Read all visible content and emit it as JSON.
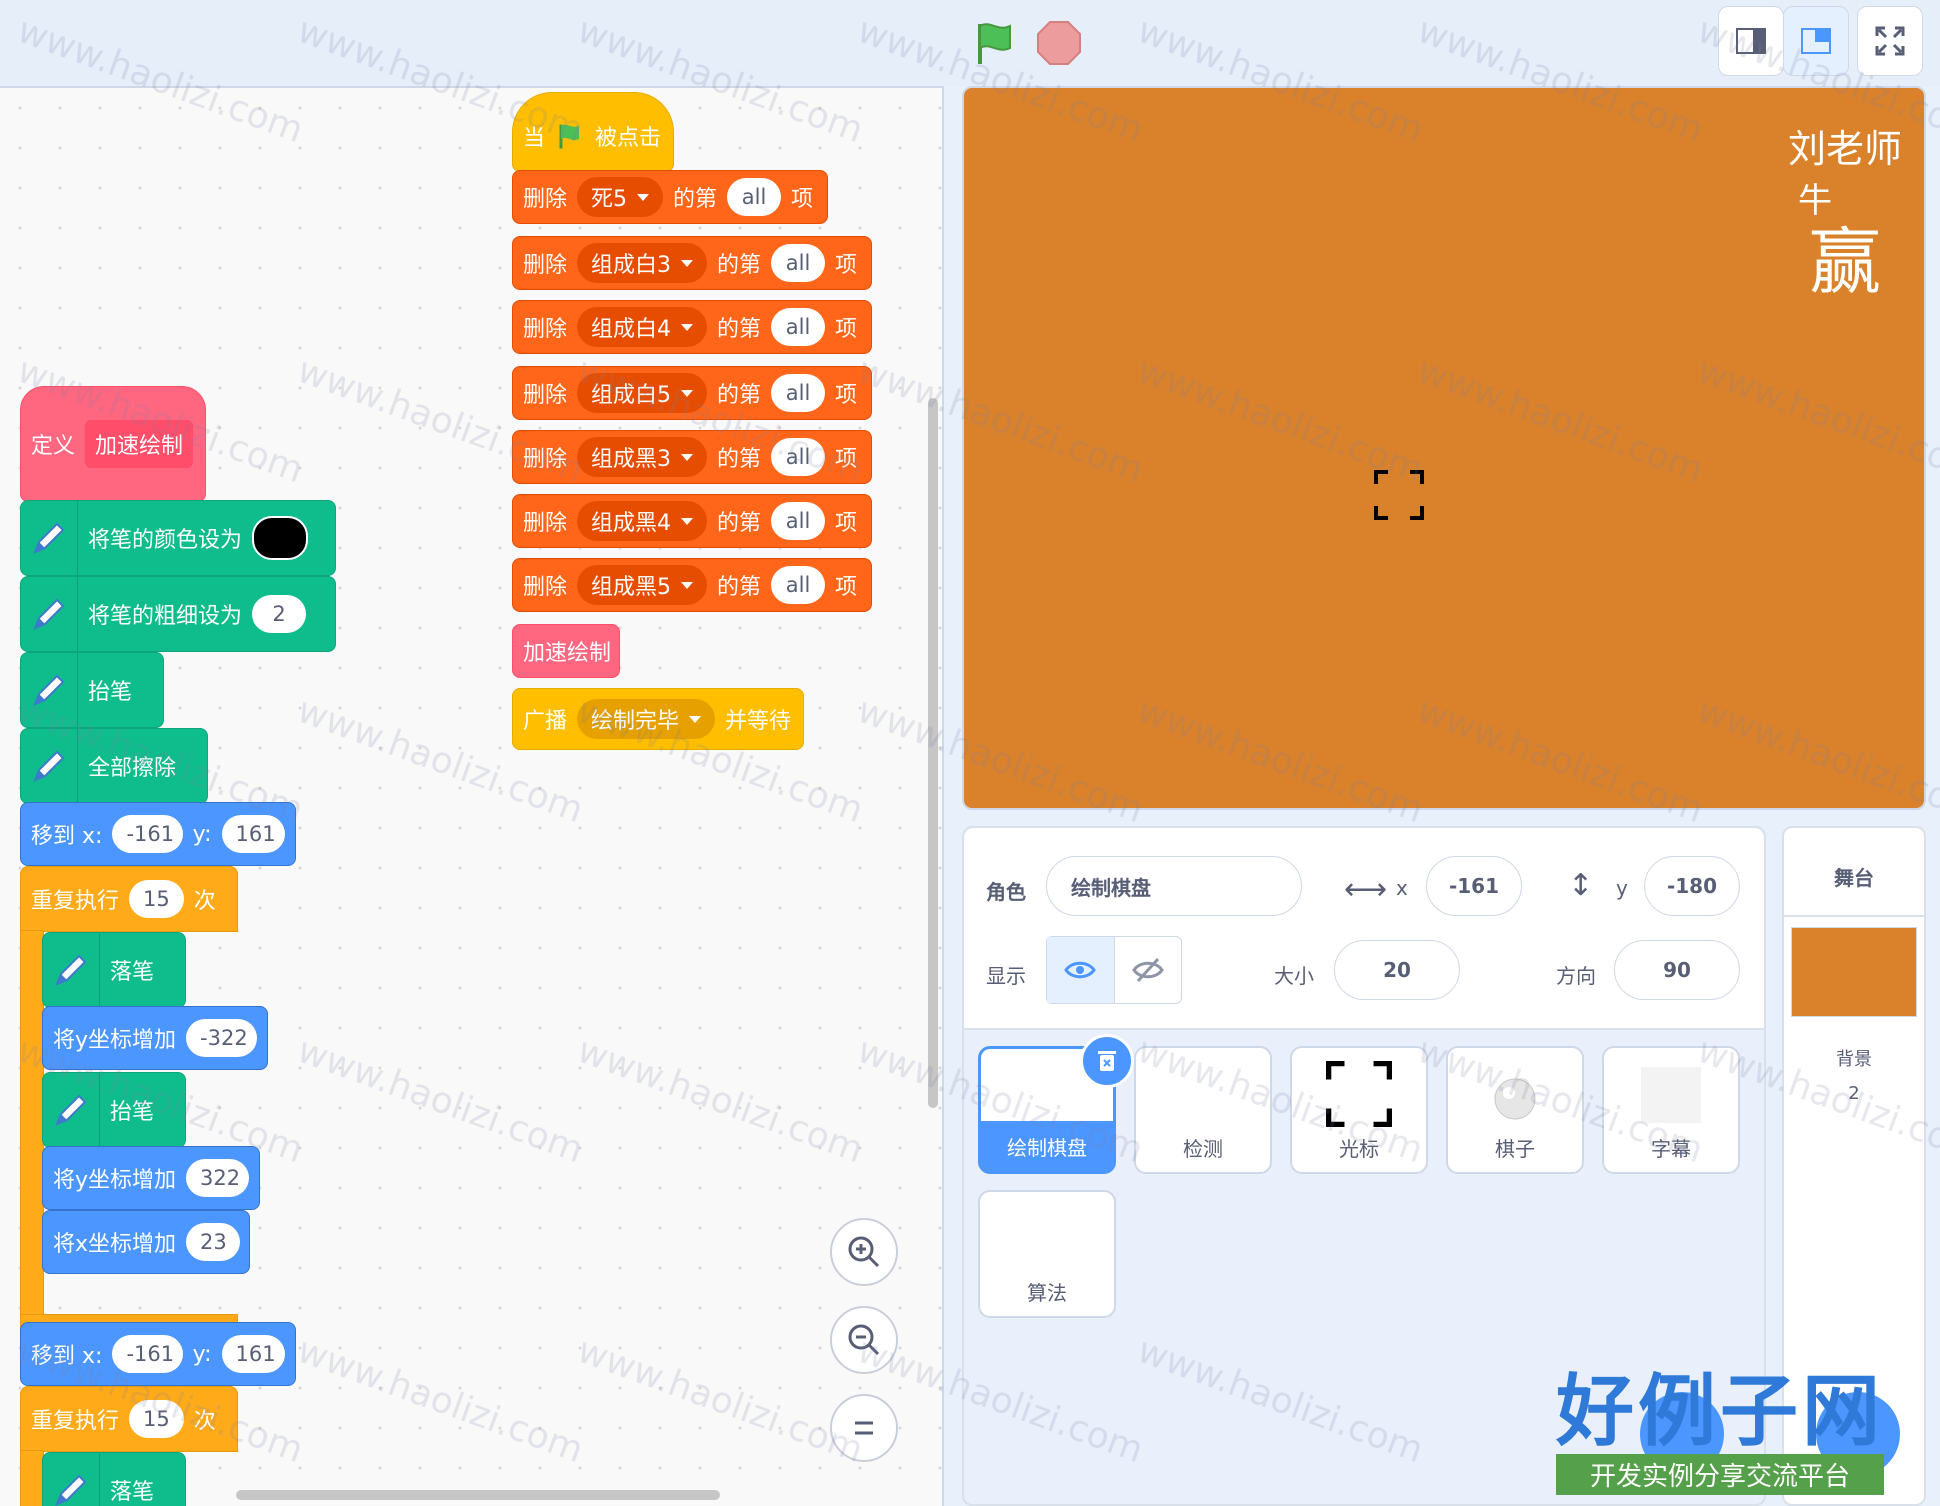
{
  "toolbar": {
    "green_flag": "green-flag-icon",
    "stop": "stop-icon"
  },
  "code": {
    "hat_when": "当",
    "hat_clicked": "被点击",
    "delete_rows": [
      {
        "verb": "删除",
        "list": "死5",
        "of": "的第",
        "item": "all",
        "suffix": "项"
      },
      {
        "verb": "删除",
        "list": "组成白3",
        "of": "的第",
        "item": "all",
        "suffix": "项"
      },
      {
        "verb": "删除",
        "list": "组成白4",
        "of": "的第",
        "item": "all",
        "suffix": "项"
      },
      {
        "verb": "删除",
        "list": "组成白5",
        "of": "的第",
        "item": "all",
        "suffix": "项"
      },
      {
        "verb": "删除",
        "list": "组成黑3",
        "of": "的第",
        "item": "all",
        "suffix": "项"
      },
      {
        "verb": "删除",
        "list": "组成黑4",
        "of": "的第",
        "item": "all",
        "suffix": "项"
      },
      {
        "verb": "删除",
        "list": "组成黑5",
        "of": "的第",
        "item": "all",
        "suffix": "项"
      }
    ],
    "call_block": "加速绘制",
    "broadcast": {
      "verb": "广播",
      "msg": "绘制完毕",
      "suffix": "并等待"
    },
    "define": {
      "verb": "定义",
      "name": "加速绘制"
    },
    "set_color": "将笔的颜色设为",
    "set_size": {
      "label": "将笔的粗细设为",
      "value": "2"
    },
    "pen_up": "抬笔",
    "clear": "全部擦除",
    "goto1": {
      "label": "移到 x:",
      "x": "-161",
      "ylabel": "y:",
      "y": "161"
    },
    "repeat1": {
      "label": "重复执行",
      "n": "15",
      "suffix": "次"
    },
    "pen_down": "落笔",
    "change_y1": {
      "label": "将y坐标增加",
      "value": "-322"
    },
    "pen_up2": "抬笔",
    "change_y2": {
      "label": "将y坐标增加",
      "value": "322"
    },
    "change_x": {
      "label": "将x坐标增加",
      "value": "23"
    },
    "goto2": {
      "label": "移到 x:",
      "x": "-161",
      "ylabel": "y:",
      "y": "161"
    },
    "repeat2": {
      "label": "重复执行",
      "n": "15",
      "suffix": "次"
    },
    "pen_down2": "落笔"
  },
  "stage": {
    "line1": "刘老师",
    "line2": "牛",
    "line3": "赢",
    "bg": "#d9822b"
  },
  "sprite_info": {
    "sprite_label": "角色",
    "sprite_name": "绘制棋盘",
    "x_label": "x",
    "x": "-161",
    "y_label": "y",
    "y": "-180",
    "show_label": "显示",
    "size_label": "大小",
    "size": "20",
    "dir_label": "方向",
    "dir": "90"
  },
  "sprites": [
    "绘制棋盘",
    "检测",
    "光标",
    "棋子",
    "字幕",
    "算法"
  ],
  "stage_panel": {
    "title": "舞台",
    "backdrop_label": "背景",
    "backdrop_count": "2"
  },
  "watermark": {
    "text": "www.haolizi.com",
    "brand": "好例子网",
    "tagline": "开发实例分享交流平台"
  }
}
